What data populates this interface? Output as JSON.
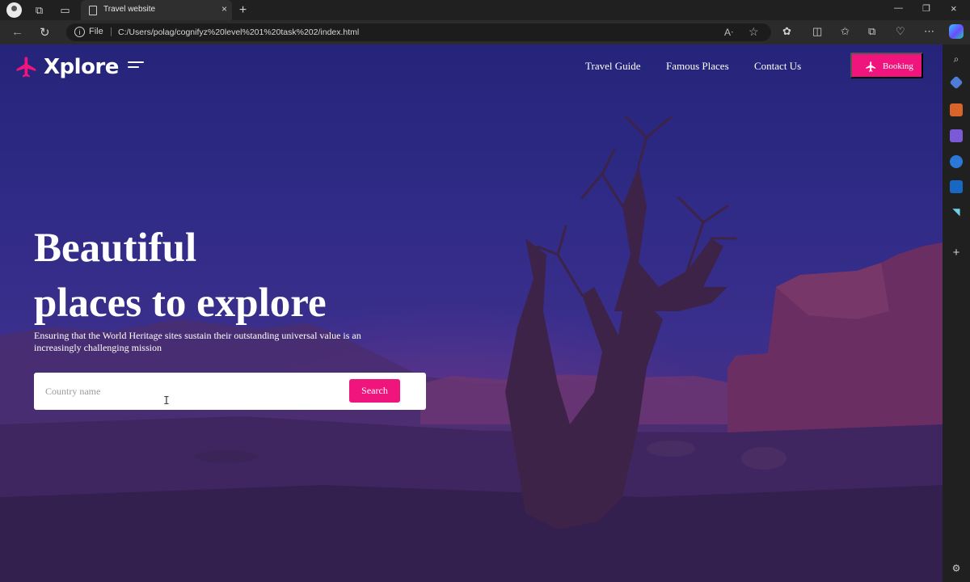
{
  "browser": {
    "tab_title": "Travel website",
    "address_scheme_label": "File",
    "url": "C:/Users/polag/cognifyz%20level%201%20task%202/index.html",
    "new_tab_symbol": "+",
    "close_symbol": "×"
  },
  "site": {
    "brand": "Xplore",
    "accent_color": "#f0157c",
    "nav": [
      {
        "label": "Travel Guide"
      },
      {
        "label": "Famous Places"
      },
      {
        "label": "Contact Us"
      }
    ],
    "booking_label": "Booking"
  },
  "hero": {
    "title_line1": "Beautiful",
    "title_line2": "places to explore",
    "subtitle": "Ensuring that the World Heritage sites sustain their outstanding universal value is an increasingly challenging mission"
  },
  "search": {
    "placeholder": "Country name",
    "value": "",
    "button_label": "Search"
  }
}
